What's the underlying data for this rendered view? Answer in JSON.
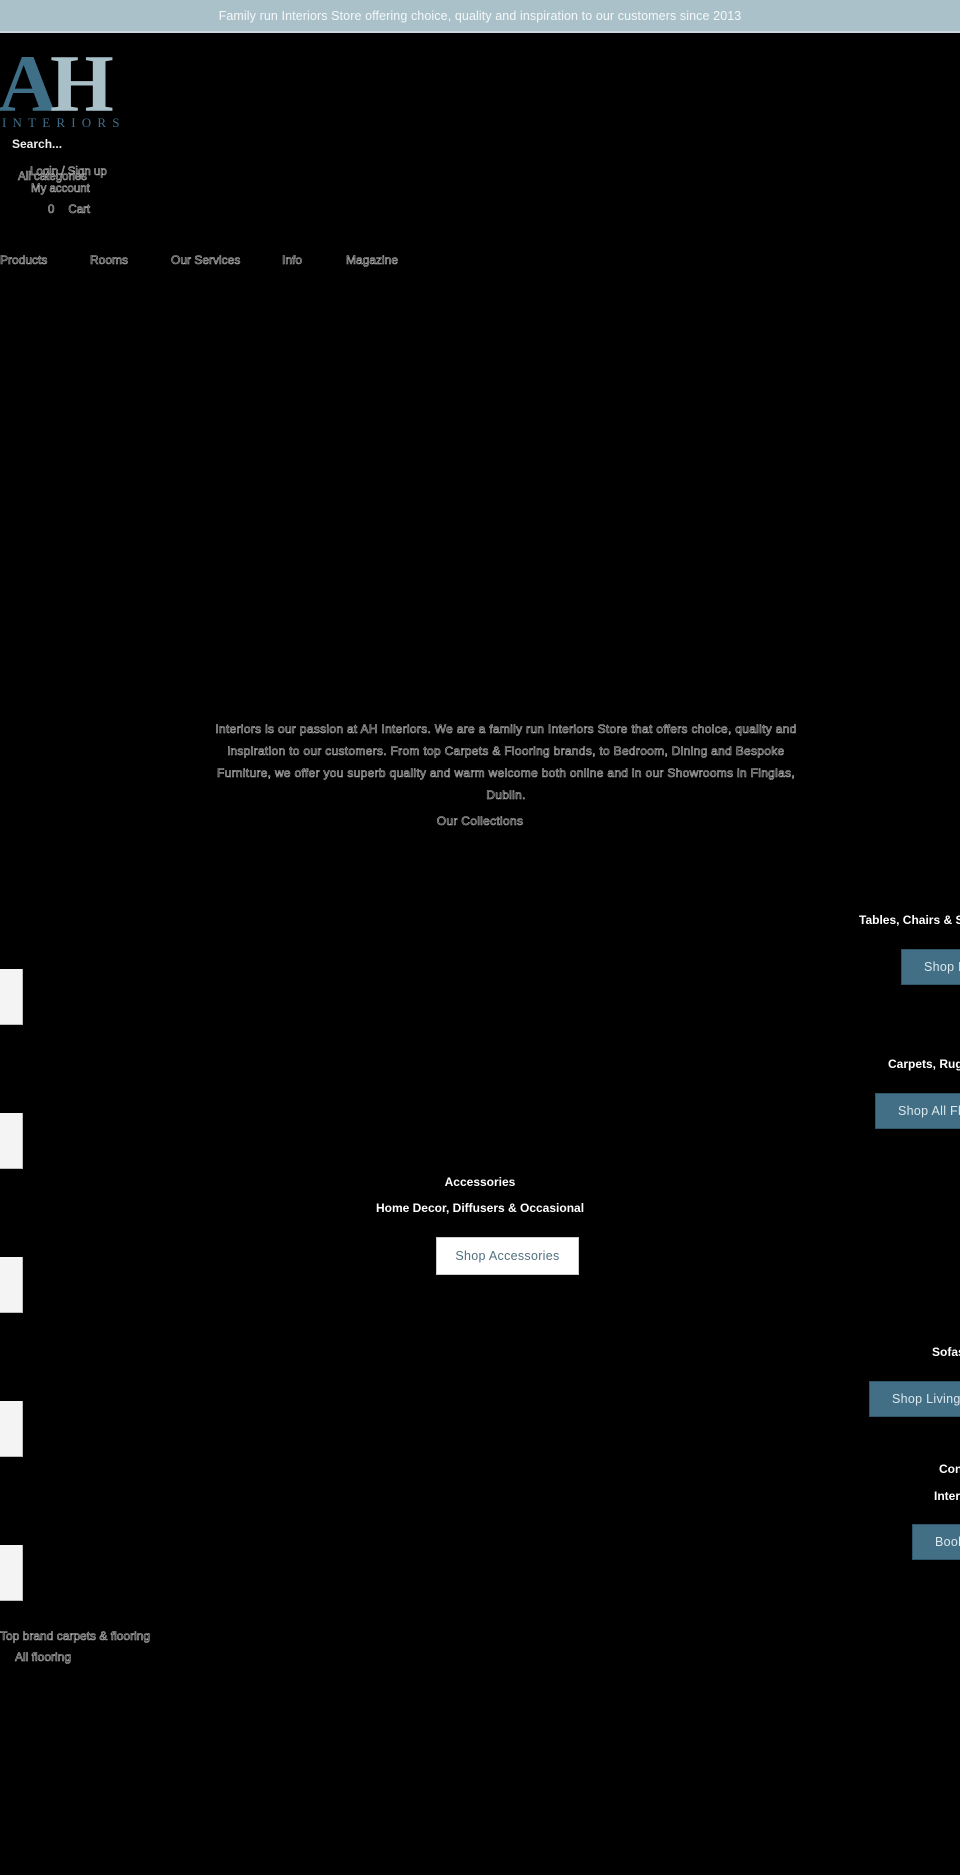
{
  "announcement": "Family run Interiors Store offering choice, quality and inspiration to our customers since 2013",
  "logo": {
    "letters": "AH",
    "wordmark": "INTERIORS",
    "colors": {
      "a": "#3f6e87",
      "h": "#a9c0c9",
      "wordmark": "#3f6e87"
    }
  },
  "header": {
    "search_placeholder": "Search...",
    "login_label": "Login / Sign up",
    "all_categories_label": "All categories",
    "my_account_label": "My account",
    "cart_count": "0",
    "cart_label": "Cart"
  },
  "nav": {
    "items": [
      {
        "label": "Products"
      },
      {
        "label": "Rooms"
      },
      {
        "label": "Our Services"
      },
      {
        "label": "Info"
      },
      {
        "label": "Magazine"
      }
    ]
  },
  "intro": {
    "text": "Interiors is our passion at AH Interiors. We are a family run Interiors Store that offers choice, quality and inspiration to our customers. From top Carpets & Flooring brands, to Bedroom, Dining and Bespoke Furniture, we offer you superb quality and warm welcome both online and in our Showrooms in Finglas, Dublin.",
    "collections_label": "Our Collections"
  },
  "collections": [
    {
      "title": "Tables, Chairs & S",
      "button": "Shop D"
    },
    {
      "title": "Carpets, Rugs",
      "button": "Shop All Flo"
    },
    {
      "title": "Accessories",
      "subtitle": "Home Decor, Diffusers & Occasional",
      "button": "Shop Accessories"
    },
    {
      "title": "Sofas",
      "button": "Shop Living R"
    },
    {
      "title": "Con",
      "subtitle": "Interi",
      "button": "Book"
    }
  ],
  "footer": {
    "heading": "Top brand carpets & flooring",
    "link": "All flooring"
  },
  "colors": {
    "accent": "#426f86",
    "topbar": "#aac1c9",
    "background": "#000000"
  }
}
